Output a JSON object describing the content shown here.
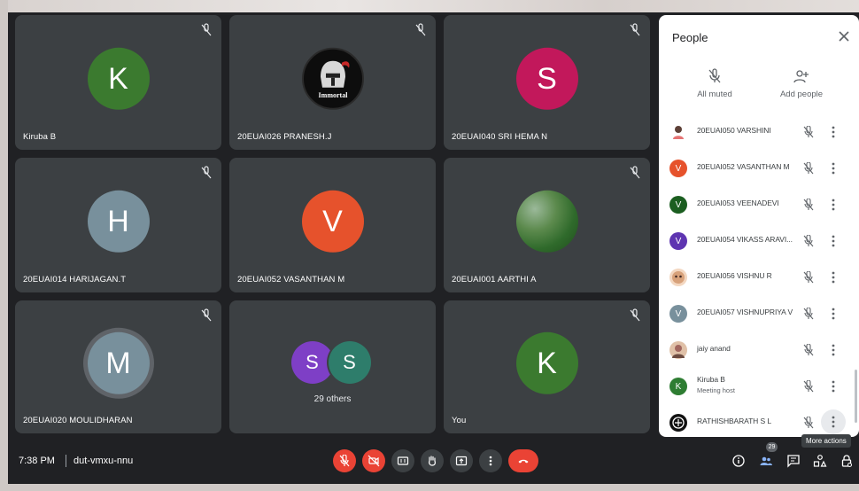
{
  "tiles": [
    {
      "name": "Kiruba B",
      "initial": "K",
      "color": "#3b7a2f",
      "muted": true
    },
    {
      "name": "20EUAI026 PRANESH.J",
      "image": "knight-logo",
      "logo_text": "Immortal",
      "muted": true
    },
    {
      "name": "20EUAI040 SRI HEMA N",
      "initial": "S",
      "color": "#c2185b",
      "muted": true
    },
    {
      "name": "20EUAI014 HARIJAGAN.T",
      "initial": "H",
      "color": "#78909c",
      "muted": true
    },
    {
      "name": "20EUAI052 VASANTHAN M",
      "initial": "V",
      "color": "#e6522c",
      "muted": false
    },
    {
      "name": "20EUAI001 AARTHI A",
      "image": "nature-photo",
      "muted": true
    },
    {
      "name": "20EUAI020 MOULIDHARAN",
      "initial": "M",
      "color": "#78909c",
      "muted": true,
      "speaking": true
    },
    {
      "name": "29 others",
      "initials": [
        "S",
        "S"
      ],
      "colors": [
        "#7e3fc6",
        "#2e7d6b"
      ],
      "muted": false
    },
    {
      "name": "You",
      "initial": "K",
      "color": "#3b7a2f",
      "muted": true
    }
  ],
  "panel": {
    "title": "People",
    "all_muted_label": "All muted",
    "add_people_label": "Add people",
    "participants": [
      {
        "name": "20EUAI050 VARSHINI",
        "avatar": "photo",
        "color": "#8d6e63"
      },
      {
        "name": "20EUAI052 VASANTHAN M",
        "initial": "V",
        "color": "#e6522c"
      },
      {
        "name": "20EUAI053 VEENADEVI",
        "initial": "V",
        "color": "#1b5e20"
      },
      {
        "name": "20EUAI054 VIKASS ARAVI...",
        "initial": "V",
        "color": "#5e35b1"
      },
      {
        "name": "20EUAI056 VISHNU R",
        "avatar": "photo",
        "color": "#d7a17a"
      },
      {
        "name": "20EUAI057 VISHNUPRIYA V",
        "initial": "V",
        "color": "#78909c"
      },
      {
        "name": "jaiy anand",
        "avatar": "photo",
        "color": "#c48a6a"
      },
      {
        "name": "Kiruba B",
        "sub": "Meeting host",
        "initial": "K",
        "color": "#2e7d32"
      },
      {
        "name": "RATHISHBARATH S L",
        "avatar": "logo",
        "color": "#111111"
      }
    ],
    "tooltip": "More actions"
  },
  "bottombar": {
    "time": "7:38 PM",
    "separator": "|",
    "meeting_code": "dut-vmxu-nnu",
    "people_count": "29"
  }
}
